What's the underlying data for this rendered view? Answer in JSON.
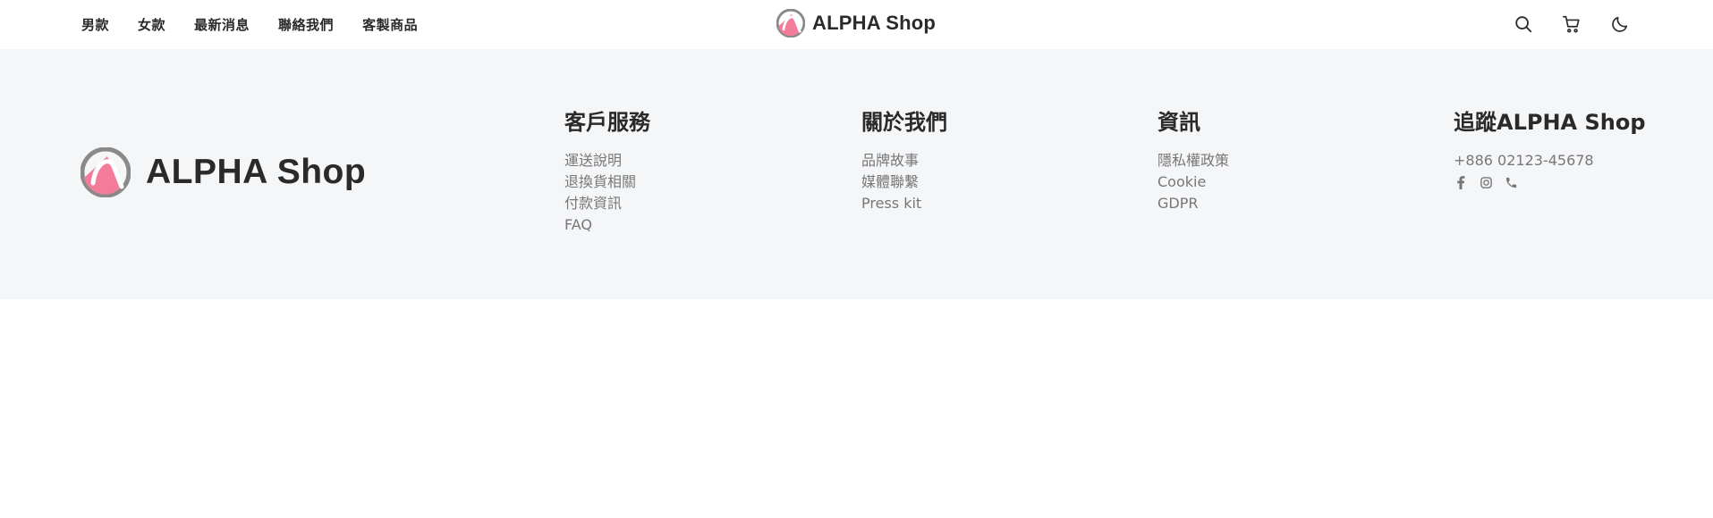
{
  "header": {
    "nav_items": [
      {
        "label": "男款"
      },
      {
        "label": "女款"
      },
      {
        "label": "最新消息"
      },
      {
        "label": "聯絡我們"
      },
      {
        "label": "客製商品"
      }
    ],
    "brand": "ALPHA Shop",
    "actions": {
      "search_icon": "search-icon",
      "cart_icon": "cart-icon",
      "theme_icon": "moon-icon"
    }
  },
  "footer": {
    "brand": "ALPHA Shop",
    "columns": [
      {
        "title": "客戶服務",
        "links": [
          "運送說明",
          "退換貨相關",
          "付款資訊",
          "FAQ"
        ]
      },
      {
        "title": "關於我們",
        "links": [
          "品牌故事",
          "媒體聯繫",
          "Press kit"
        ]
      },
      {
        "title": "資訊",
        "links": [
          "隱私權政策",
          "Cookie",
          "GDPR"
        ]
      },
      {
        "title": "追蹤ALPHA Shop",
        "phone": "+886 02123-45678",
        "social": [
          "facebook-icon",
          "instagram-icon",
          "phone-icon"
        ]
      }
    ]
  },
  "colors": {
    "brand_pink": "#f47c9b",
    "brand_gray": "#8a8a8a",
    "footer_bg": "#f5f6f8",
    "text_dark": "#2a2a2a",
    "text_muted": "#777777"
  }
}
